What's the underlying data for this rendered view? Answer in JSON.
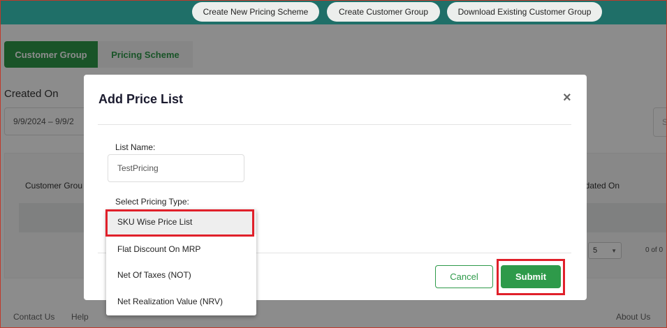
{
  "header": {
    "buttons": [
      "Create New Pricing Scheme",
      "Create Customer Group",
      "Download Existing Customer Group"
    ]
  },
  "tabs": [
    {
      "label": "Customer Group",
      "active": true
    },
    {
      "label": "Pricing Scheme",
      "active": false
    }
  ],
  "filters": {
    "created_on_label": "Created On",
    "date_range": "9/9/2024 – 9/9/2"
  },
  "search_right_char": "S",
  "table": {
    "col_left": "Customer Grou",
    "col_right": "pdated On",
    "page_size": "5",
    "count": "0 of 0"
  },
  "footer": {
    "contact": "Contact Us",
    "help": "Help",
    "about": "About Us"
  },
  "modal": {
    "title": "Add Price List",
    "close_symbol": "×",
    "list_name_label": "List Name:",
    "list_name_value": "TestPricing",
    "pricing_type_label": "Select Pricing Type:",
    "pricing_types": [
      "SKU Wise Price List",
      "Flat Discount On MRP",
      "Net Of Taxes (NOT)",
      "Net Realization Value (NRV)"
    ],
    "selected_pricing_type": "SKU Wise Price List",
    "cancel_label": "Cancel",
    "submit_label": "Submit"
  },
  "colors": {
    "brand_green": "#2e9a4a",
    "topbar": "#1f6f68",
    "highlight_red": "#e0202a"
  }
}
